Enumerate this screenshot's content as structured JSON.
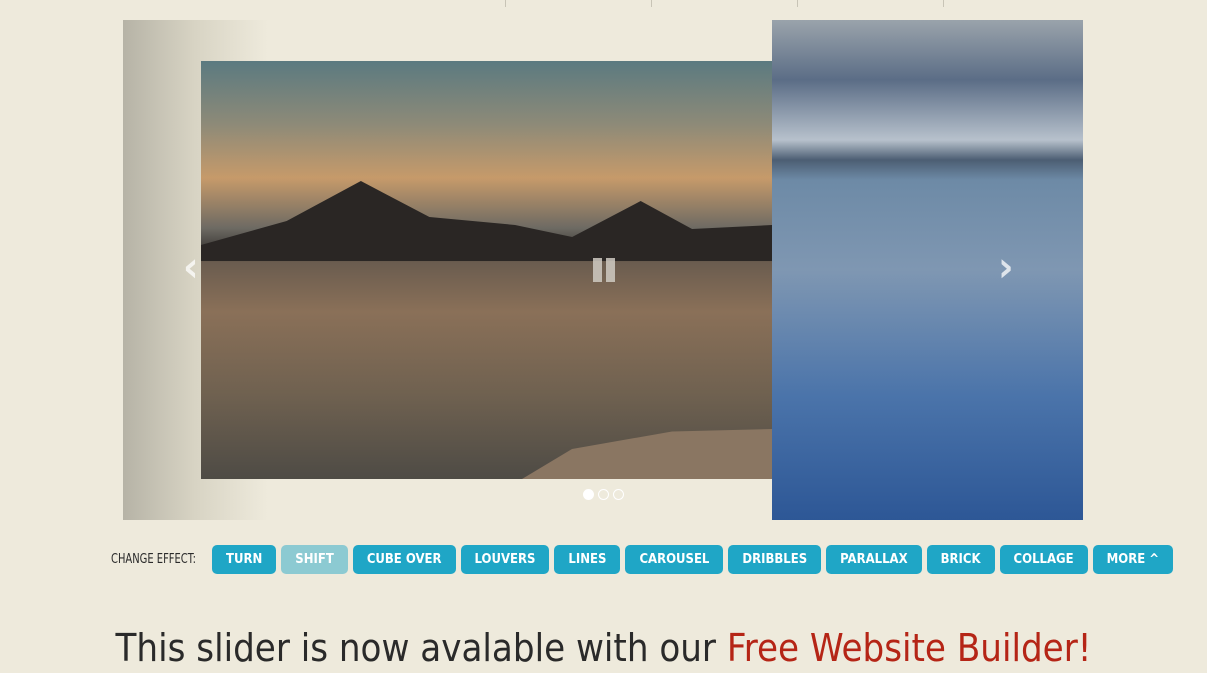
{
  "slider": {
    "slides": 3,
    "active_slide": 1,
    "prev_icon": "chevron-left-icon",
    "next_icon": "chevron-right-icon",
    "pause_icon": "pause-icon"
  },
  "effects": {
    "label": "CHANGE EFFECT:",
    "buttons": [
      "TURN",
      "SHIFT",
      "CUBE OVER",
      "LOUVERS",
      "LINES",
      "CAROUSEL",
      "DRIBBLES",
      "PARALLAX",
      "BRICK",
      "COLLAGE",
      "MORE ^"
    ],
    "active": "SHIFT",
    "colors": {
      "button": "#1fa6c6",
      "active": "#8ccad2"
    }
  },
  "promo": {
    "text": "This slider is now avalable with our ",
    "link": "Free Website Builder!",
    "link_color": "#b52516"
  }
}
